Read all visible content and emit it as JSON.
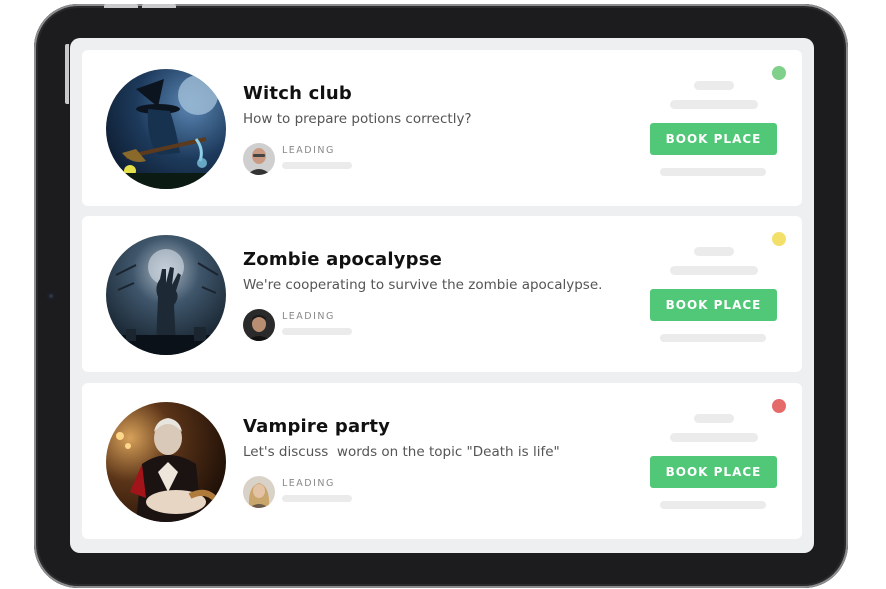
{
  "cards": [
    {
      "title": "Witch club",
      "subtitle": "How to prepare potions correctly?",
      "leading_label": "LEADING",
      "button_label": "BOOK PLACE",
      "status_color": "#7ed08a"
    },
    {
      "title": "Zombie apocalypse",
      "subtitle": "We're cooperating to survive the zombie apocalypse.",
      "leading_label": "LEADING",
      "button_label": "BOOK PLACE",
      "status_color": "#f3e06b"
    },
    {
      "title": "Vampire party",
      "subtitle": "Let's discuss  words on the topic \"Death is life\"",
      "leading_label": "LEADING",
      "button_label": "BOOK PLACE",
      "status_color": "#e56b6b"
    }
  ],
  "colors": {
    "accent": "#50c878",
    "device_frame": "#1c1c1e",
    "screen_bg": "#eeeff1",
    "placeholder": "#ebebeb"
  },
  "icons": {
    "event_images": [
      "witch-image",
      "zombie-hand-image",
      "vampire-image"
    ],
    "host_avatars": [
      "bald-man-avatar",
      "dark-hair-man-avatar",
      "blonde-woman-avatar"
    ]
  }
}
